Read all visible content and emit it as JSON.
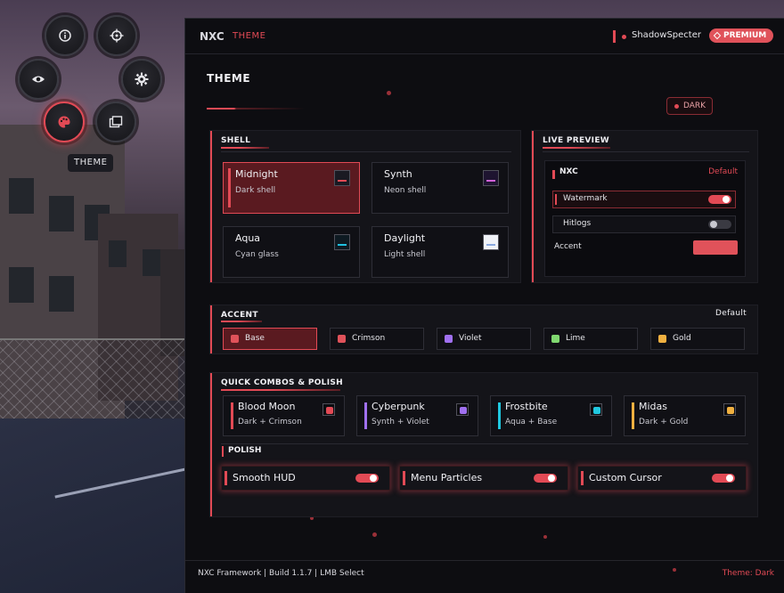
{
  "radial_menu": {
    "items": [
      {
        "name": "info-button",
        "icon": "info-icon"
      },
      {
        "name": "crosshair-button",
        "icon": "crosshair-icon"
      },
      {
        "name": "visuals-button",
        "icon": "eye-icon"
      },
      {
        "name": "settings-button",
        "icon": "gear-icon"
      },
      {
        "name": "theme-button",
        "icon": "palette-icon",
        "active": true
      },
      {
        "name": "configs-button",
        "icon": "folders-icon"
      }
    ],
    "tooltip": "THEME"
  },
  "header": {
    "brand": "NXC",
    "section": "THEME",
    "username": "ShadowSpecter",
    "badge": "PREMIUM"
  },
  "view": {
    "title": "THEME",
    "mode_chip": "DARK"
  },
  "shell": {
    "heading": "SHELL",
    "options": [
      {
        "name": "Midnight",
        "sub": "Dark shell",
        "swatch_bg": "#1a1a22",
        "swatch_line": "#e24a55",
        "selected": true
      },
      {
        "name": "Synth",
        "sub": "Neon shell",
        "swatch_bg": "#1e1430",
        "swatch_line": "#d060d8",
        "selected": false
      },
      {
        "name": "Aqua",
        "sub": "Cyan glass",
        "swatch_bg": "#0e1a22",
        "swatch_line": "#20c0e0",
        "selected": false
      },
      {
        "name": "Daylight",
        "sub": "Light shell",
        "swatch_bg": "#f0f2f8",
        "swatch_line": "#8aa8e0",
        "selected": false
      }
    ]
  },
  "preview": {
    "heading": "LIVE PREVIEW",
    "title": "NXC",
    "preset": "Default",
    "rows": [
      {
        "label": "Watermark",
        "on": true
      },
      {
        "label": "Hitlogs",
        "on": false
      }
    ],
    "accent_label": "Accent",
    "accent_color": "#e0525a"
  },
  "accent": {
    "heading": "ACCENT",
    "preset": "Default",
    "options": [
      {
        "label": "Base",
        "color": "#e0525a",
        "selected": true
      },
      {
        "label": "Crimson",
        "color": "#e0525a",
        "selected": false
      },
      {
        "label": "Violet",
        "color": "#a070f0",
        "selected": false
      },
      {
        "label": "Lime",
        "color": "#80d870",
        "selected": false
      },
      {
        "label": "Gold",
        "color": "#f0b040",
        "selected": false
      }
    ]
  },
  "combos": {
    "heading": "QUICK COMBOS & POLISH",
    "items": [
      {
        "name": "Blood Moon",
        "sub": "Dark + Crimson",
        "color": "#e24a55"
      },
      {
        "name": "Cyberpunk",
        "sub": "Synth + Violet",
        "color": "#a070f0"
      },
      {
        "name": "Frostbite",
        "sub": "Aqua + Base",
        "color": "#20c8e0"
      },
      {
        "name": "Midas",
        "sub": "Dark + Gold",
        "color": "#f0b040"
      }
    ]
  },
  "polish": {
    "heading": "POLISH",
    "items": [
      {
        "label": "Smooth HUD",
        "on": true
      },
      {
        "label": "Menu Particles",
        "on": true
      },
      {
        "label": "Custom Cursor",
        "on": true
      }
    ]
  },
  "footer": {
    "left": "NXC Framework | Build 1.1.7 | LMB Select",
    "right": "Theme: Dark"
  },
  "colors": {
    "accent": "#e24a55",
    "panel_bg": "#0d0d11"
  }
}
